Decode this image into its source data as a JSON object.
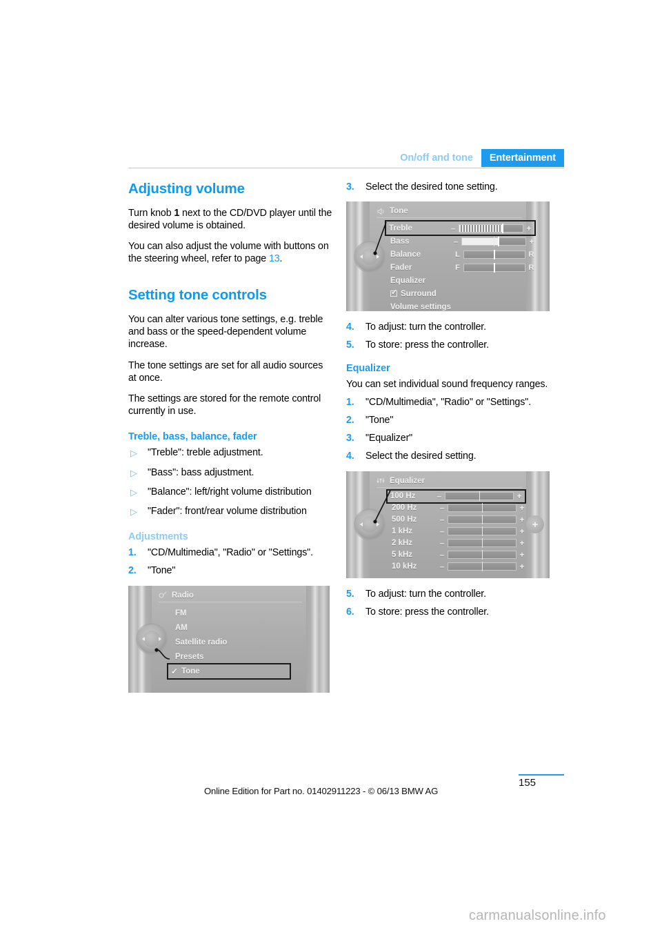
{
  "header": {
    "chapter": "On/off and tone",
    "section": "Entertainment"
  },
  "left_column": {
    "title_volume": "Adjusting volume",
    "p1_before": "Turn knob ",
    "p1_bold": "1",
    "p1_after": " next to the CD/DVD player until the desired volume is obtained.",
    "p2_before": "You can also adjust the volume with buttons on the steering wheel, refer to page ",
    "p2_pageref": "13",
    "p2_after": ".",
    "title_tone": "Setting tone controls",
    "p3": "You can alter various tone settings, e.g. treble and bass or the speed-dependent volume increase.",
    "p4": "The tone settings are set for all audio sources at once.",
    "p5": "The settings are stored for the remote control currently in use.",
    "sub_treble": "Treble, bass, balance, fader",
    "bullets": [
      "\"Treble\": treble adjustment.",
      "\"Bass\": bass adjustment.",
      "\"Balance\": left/right volume distribution",
      "\"Fader\": front/rear volume distribution"
    ],
    "bullet_marker": "▷",
    "sub_adjustments": "Adjustments",
    "steps": [
      {
        "num": "1.",
        "text": "\"CD/Multimedia\", \"Radio\" or \"Settings\"."
      },
      {
        "num": "2.",
        "text": "\"Tone\""
      }
    ]
  },
  "right_column": {
    "step3": {
      "num": "3.",
      "text": "Select the desired tone setting."
    },
    "steps_after_tone": [
      {
        "num": "4.",
        "text": "To adjust: turn the controller."
      },
      {
        "num": "5.",
        "text": "To store: press the controller."
      }
    ],
    "sub_equalizer": "Equalizer",
    "p_equalizer": "You can set individual sound frequency ranges.",
    "eq_steps": [
      {
        "num": "1.",
        "text": "\"CD/Multimedia\", \"Radio\" or \"Settings\"."
      },
      {
        "num": "2.",
        "text": "\"Tone\""
      },
      {
        "num": "3.",
        "text": "\"Equalizer\""
      },
      {
        "num": "4.",
        "text": "Select the desired setting."
      }
    ],
    "eq_steps_after": [
      {
        "num": "5.",
        "text": "To adjust: turn the controller."
      },
      {
        "num": "6.",
        "text": "To store: press the controller."
      }
    ]
  },
  "screens": {
    "radio": {
      "title": "Radio",
      "items": [
        "FM",
        "AM",
        "Satellite radio",
        "Presets"
      ],
      "selected_item": "Tone"
    },
    "tone": {
      "title": "Tone",
      "rows": [
        {
          "label": "Treble",
          "type": "slider_ticks",
          "selected": true
        },
        {
          "label": "Bass",
          "type": "slider_fill",
          "selected": false
        },
        {
          "label": "Balance",
          "type": "slider_lr",
          "left": "L",
          "right": "R",
          "selected": false
        },
        {
          "label": "Fader",
          "type": "slider_lr",
          "left": "F",
          "right": "R",
          "selected": false
        },
        {
          "label": "Equalizer",
          "type": "plain",
          "selected": false
        },
        {
          "label": "Surround",
          "type": "checkbox",
          "checked": true,
          "selected": false
        },
        {
          "label": "Volume settings",
          "type": "plain",
          "selected": false
        }
      ]
    },
    "equalizer": {
      "title": "Equalizer",
      "bands": [
        "100 Hz",
        "200 Hz",
        "500 Hz",
        "1 kHz",
        "2 kHz",
        "5 kHz",
        "10 kHz"
      ],
      "selected_band": "100 Hz",
      "minus": "–",
      "plus": "+"
    }
  },
  "footer": {
    "note": "Online Edition for Part no. 01402911223 - © 06/13 BMW AG",
    "page_number": "155",
    "watermark": "carmanualsonline.info"
  },
  "colors": {
    "accent": "#1C9BEF",
    "accent_light": "#8ECBF4",
    "title": "#0D9BF0"
  }
}
